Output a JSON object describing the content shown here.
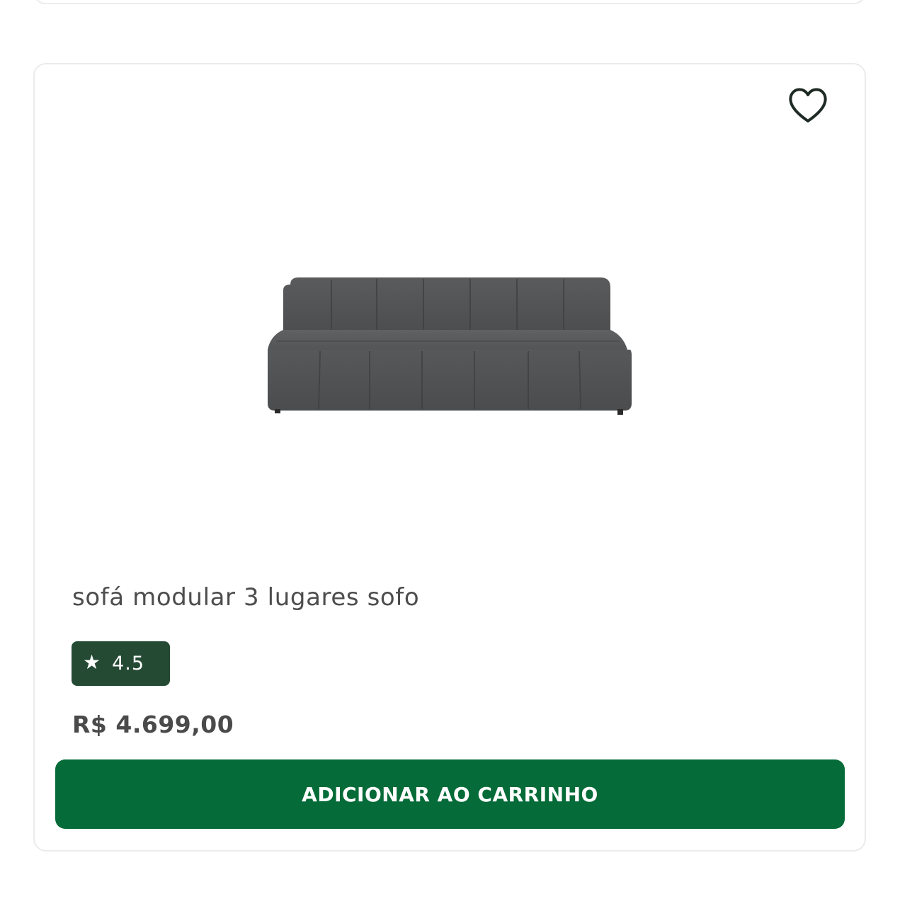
{
  "product": {
    "name": "sofá modular 3 lugares sofo",
    "rating": "4.5",
    "price": "R$ 4.699,00",
    "image_icon": "sofa-image",
    "favorite_icon": "heart-outline-icon",
    "rating_icon": "star-icon"
  },
  "actions": {
    "add_to_cart_label": "ADICIONAR AO CARRINHO"
  },
  "colors": {
    "primary_button": "#056b38",
    "rating_badge": "#244a34",
    "text": "#4d4d4d",
    "card_border": "#ebebeb"
  }
}
